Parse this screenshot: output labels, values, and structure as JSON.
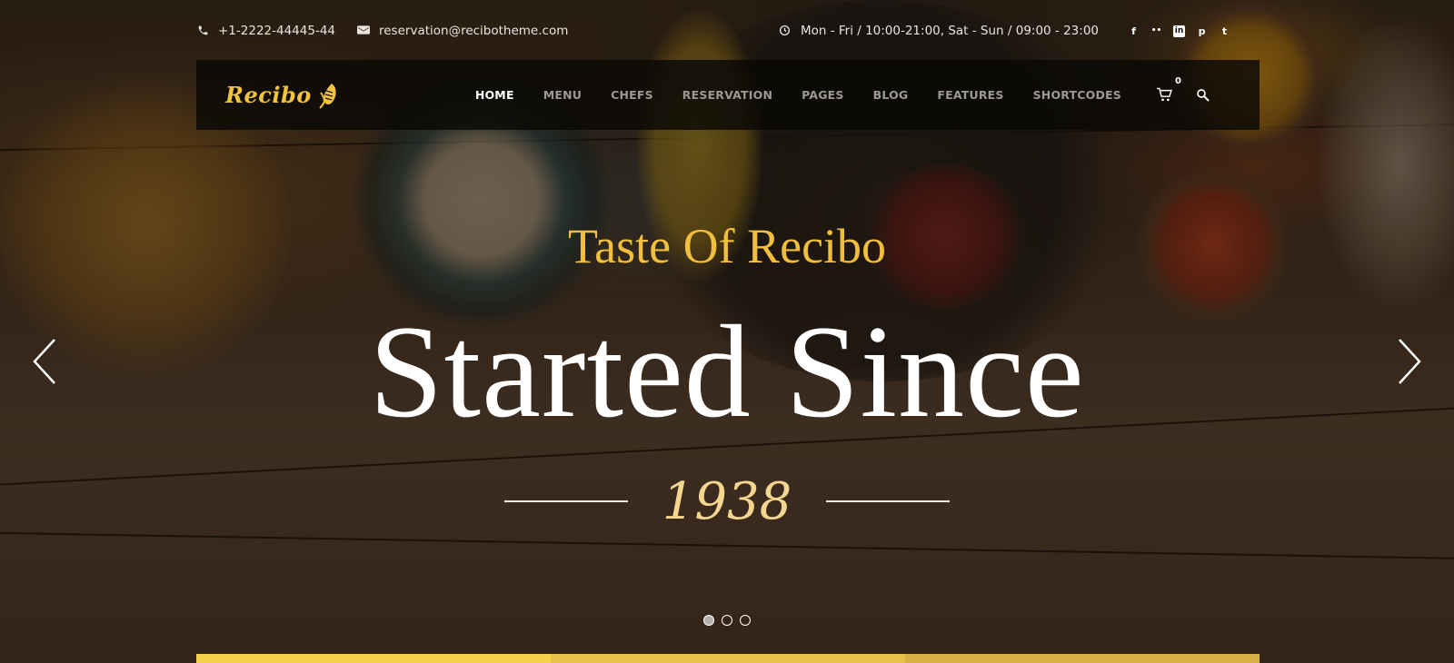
{
  "topbar": {
    "phone": "+1-2222-44445-44",
    "email": "reservation@recibotheme.com",
    "hours": "Mon - Fri / 10:00-21:00, Sat - Sun / 09:00 - 23:00",
    "icons": [
      "phone-icon",
      "envelope-icon",
      "clock-icon"
    ],
    "social": [
      "facebook-icon",
      "flickr-icon",
      "linkedin-icon",
      "pinterest-icon",
      "twitter-icon"
    ],
    "social_glyphs": [
      "f",
      "••",
      "in",
      "p",
      "t"
    ]
  },
  "nav": {
    "logo": "Recibo",
    "items": [
      {
        "label": "HOME",
        "active": true
      },
      {
        "label": "MENU"
      },
      {
        "label": "CHEFS"
      },
      {
        "label": "RESERVATION"
      },
      {
        "label": "PAGES"
      },
      {
        "label": "BLOG"
      },
      {
        "label": "FEATURES"
      },
      {
        "label": "SHORTCODES"
      }
    ],
    "cart_count": "0"
  },
  "hero": {
    "subtitle": "Taste Of Recibo",
    "title": "Started Since",
    "year": "1938"
  },
  "slider": {
    "slide_count": 3,
    "active_slide": 1
  },
  "colors": {
    "accent": "#f1bf3c",
    "year": "#f5d690",
    "strip": [
      "#f6d24a",
      "#e8c04a",
      "#d8b046"
    ]
  }
}
